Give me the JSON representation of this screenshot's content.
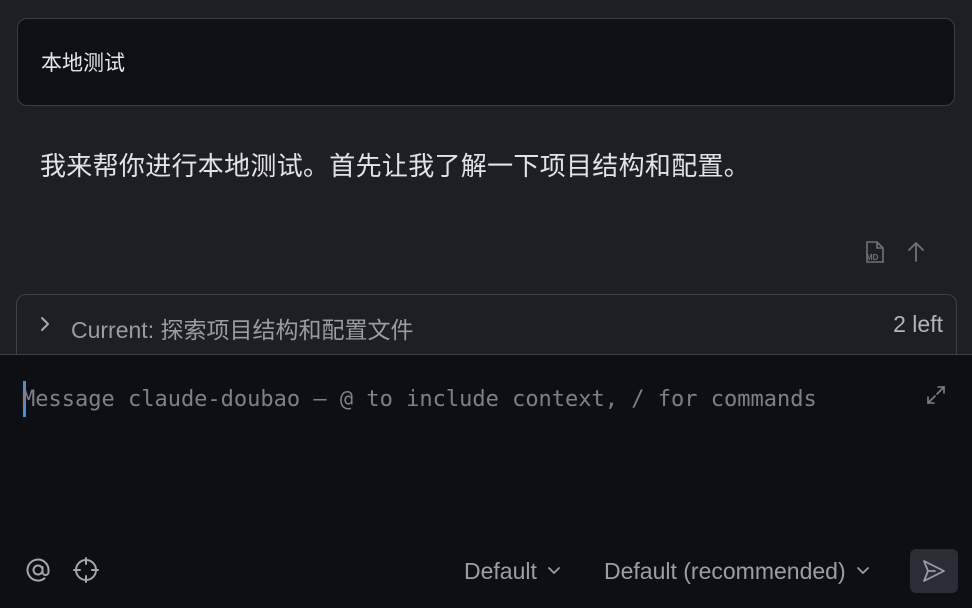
{
  "user_message": {
    "text": "本地测试"
  },
  "assistant_message": {
    "text": "我来帮你进行本地测试。首先让我了解一下项目结构和配置。"
  },
  "message_actions": {
    "icons": [
      "markdown-file-icon",
      "arrow-up-icon"
    ]
  },
  "current_task": {
    "label": "Current:",
    "task": "探索项目结构和配置文件",
    "remaining": "2 left"
  },
  "composer": {
    "value": "",
    "placeholder": "Message claude-doubao — @ to include context, / for commands",
    "mode_dropdown": "Default",
    "model_dropdown": "Default (recommended)"
  },
  "colors": {
    "accent": "#4a90d9",
    "background": "#1e1f25",
    "composer_bg": "#0d0f15"
  }
}
